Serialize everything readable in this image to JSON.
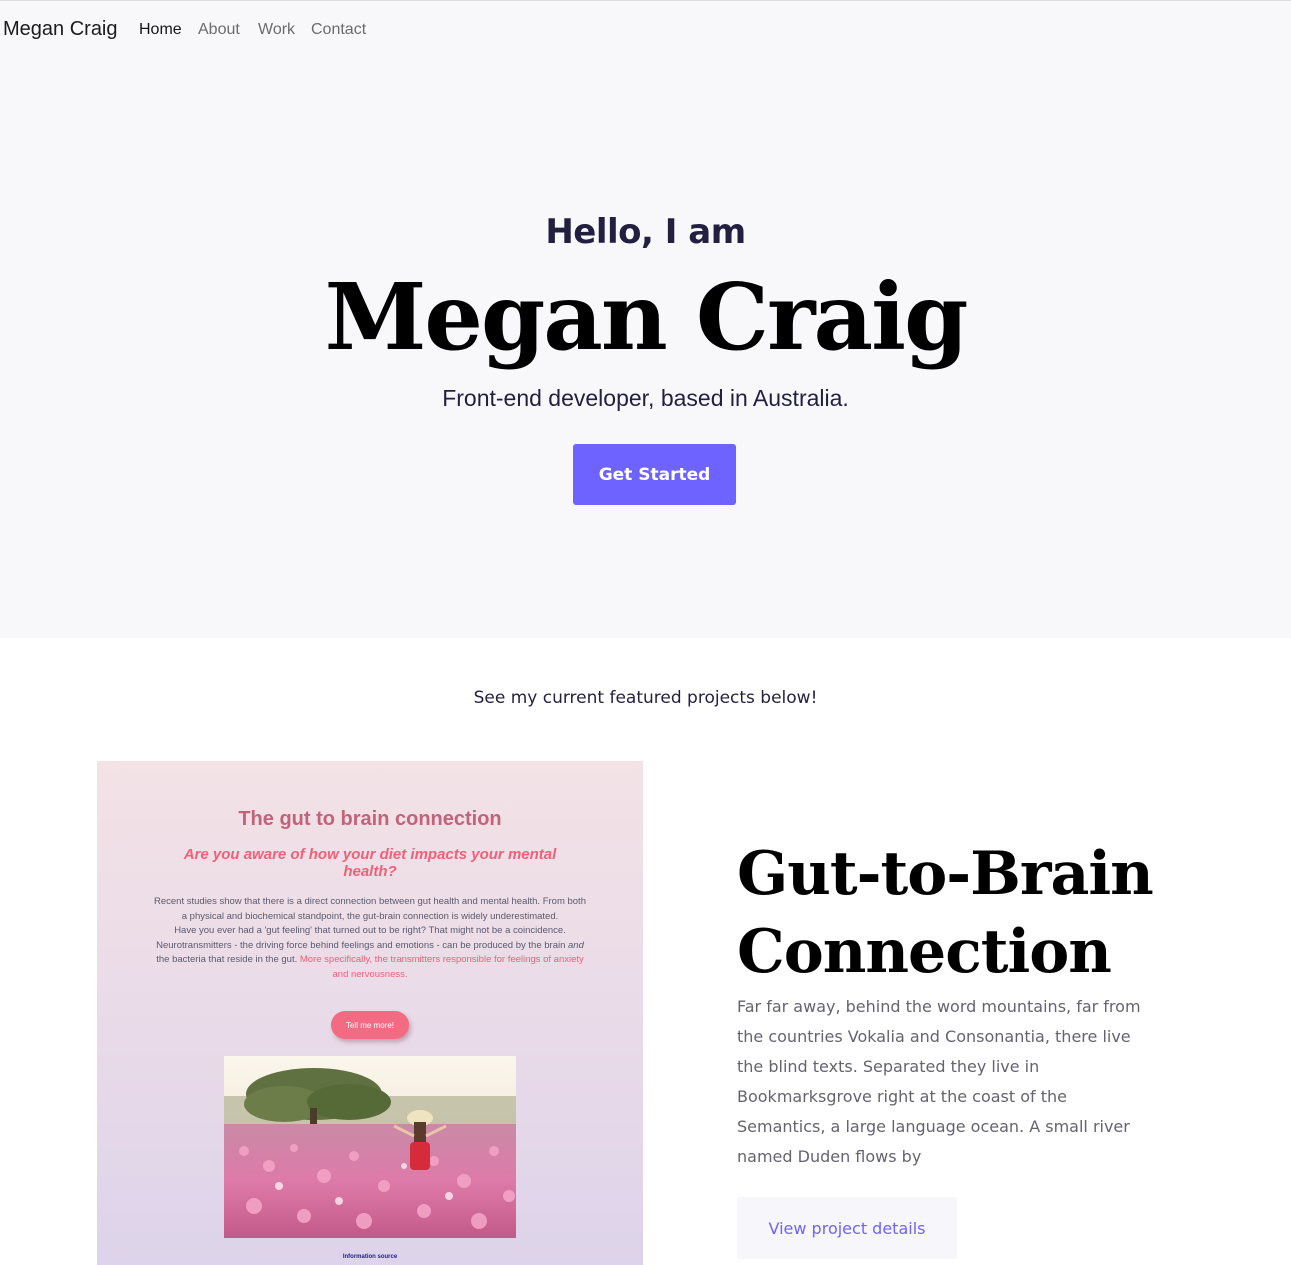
{
  "nav": {
    "brand": "Megan Craig",
    "links": [
      "Home",
      "About",
      "Work",
      "Contact"
    ],
    "active": "Home"
  },
  "hero": {
    "greeting": "Hello, I am",
    "name": "Megan Craig",
    "subtitle": "Front-end developer, based in Australia.",
    "cta_label": "Get Started"
  },
  "projects": {
    "intro": "See my current featured projects below!",
    "featured": {
      "title": "Gut-to-Brain Connection",
      "description": "Far far away, behind the word mountains, far from the countries Vokalia and Consonantia, there live the blind texts. Separated they live in Bookmarksgrove right at the coast of the Semantics, a large language ocean. A small river named Duden flows by",
      "link_label": "View project details",
      "screenshot": {
        "title": "The gut to brain connection",
        "question": "Are you aware of how your diet impacts your mental health?",
        "body_1": "Recent studies show that there is a direct connection between gut health and mental health. From both a physical and biochemical standpoint, the gut-brain connection is widely underestimated.",
        "body_2": "Have you ever had a 'gut feeling' that turned out to be right? That might not be a coincidence. Neurotransmitters - the driving force behind feelings and emotions - can be produced by the brain",
        "body_2_em": "and",
        "body_2_end": "the bacteria that reside in the gut.",
        "body_highlight": "More specifically, the transmitters responsible for feelings of anxiety and nervousness.",
        "button_label": "Tell me more!",
        "source_label": "Information source"
      }
    }
  },
  "colors": {
    "accent": "#6f63ff",
    "hero_bg": "#f8f8fb",
    "heading_dark": "#231f40",
    "pink": "#f0607a"
  }
}
